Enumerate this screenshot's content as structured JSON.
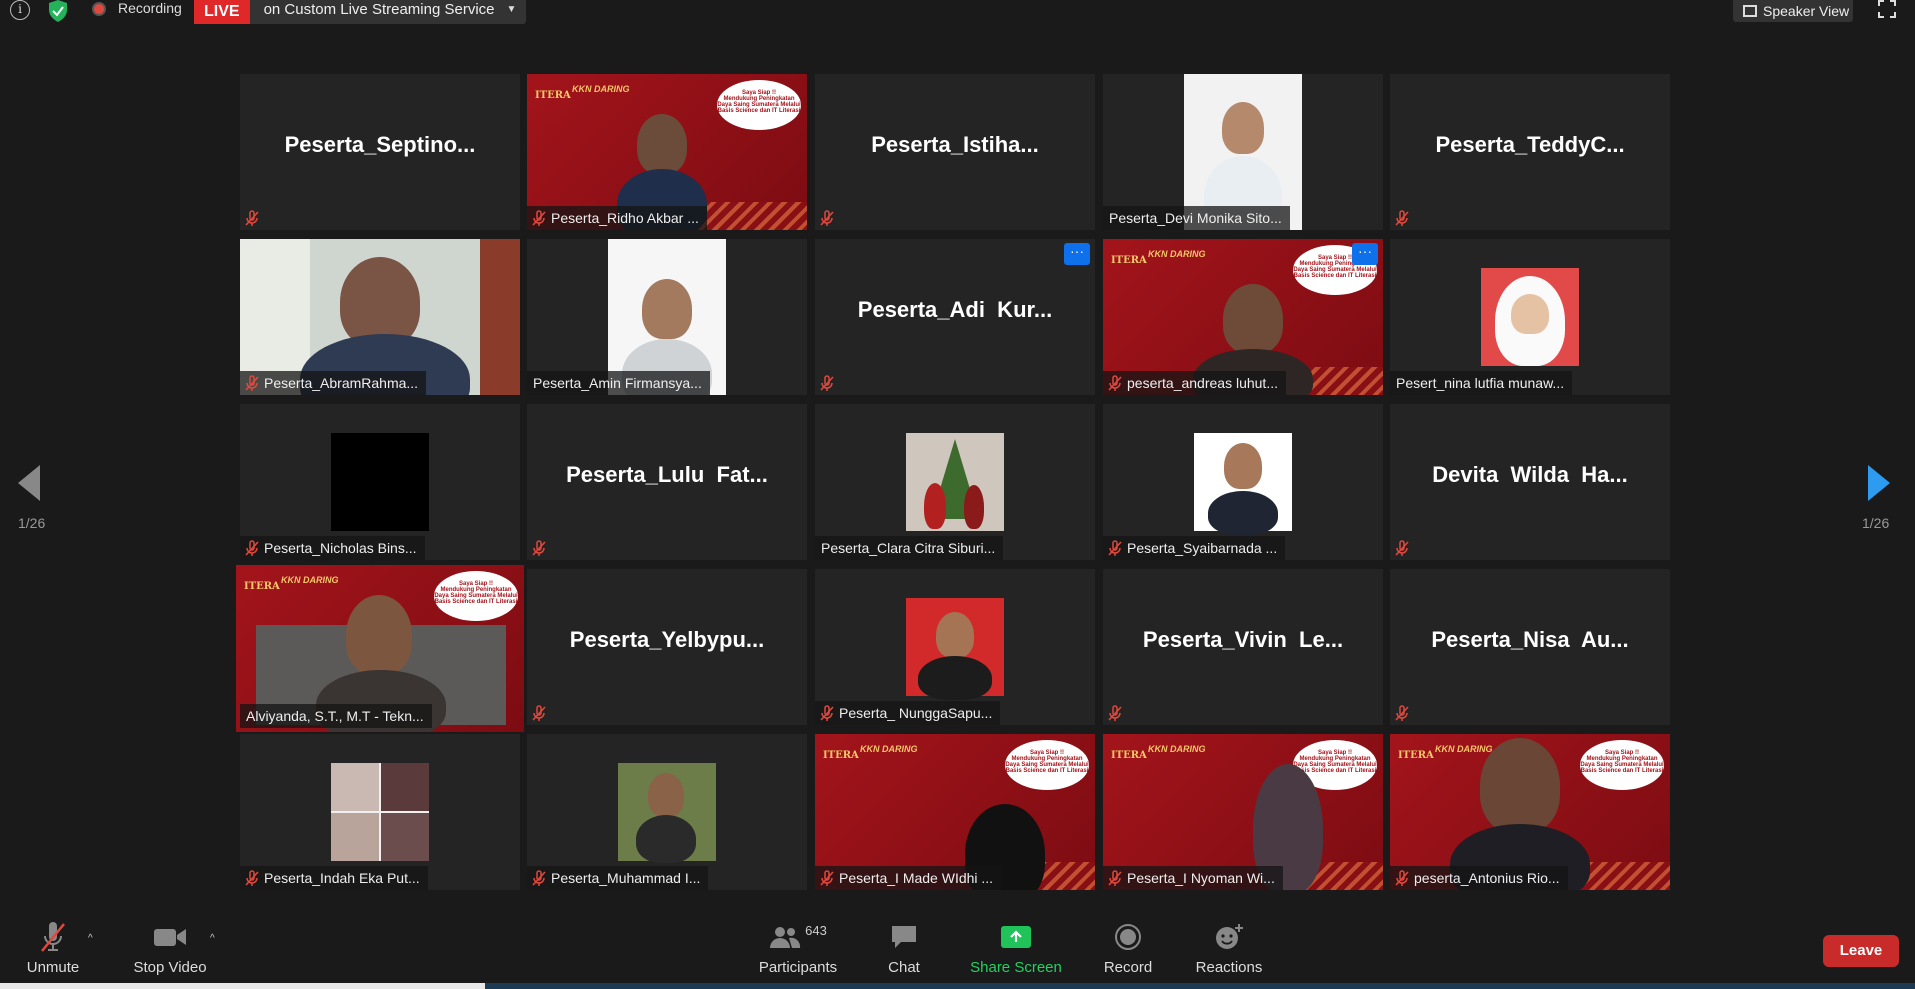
{
  "topbar": {
    "recording_label": "Recording",
    "live_badge": "LIVE",
    "live_text": "on Custom Live Streaming Service",
    "speaker_view_label": "Speaker View"
  },
  "navigation": {
    "prev_page": "1/26",
    "next_page": "1/26"
  },
  "tiles": [
    {
      "kind": "name",
      "big": "Peserta_Septino...",
      "label": ""
    },
    {
      "kind": "banner",
      "label": "Peserta_Ridho Akbar ..."
    },
    {
      "kind": "name",
      "big": "Peserta_Istiha...",
      "label": ""
    },
    {
      "kind": "photo",
      "label": "Peserta_Devi Monika Sito..."
    },
    {
      "kind": "name",
      "big": "Peserta_TeddyC...",
      "label": ""
    },
    {
      "kind": "video",
      "label": "Peserta_AbramRahma..."
    },
    {
      "kind": "photo",
      "label": "Peserta_Amin Firmansya..."
    },
    {
      "kind": "name",
      "big": "Peserta_Adi  Kur...",
      "label": ""
    },
    {
      "kind": "banner",
      "label": "peserta_andreas luhut..."
    },
    {
      "kind": "photo",
      "label": "Pesert_nina lutfia munaw..."
    },
    {
      "kind": "photo",
      "label": "Peserta_Nicholas Bins..."
    },
    {
      "kind": "name",
      "big": "Peserta_Lulu  Fat...",
      "label": ""
    },
    {
      "kind": "photo",
      "label": "Peserta_Clara Citra Siburi..."
    },
    {
      "kind": "photo",
      "label": "Peserta_Syaibarnada ..."
    },
    {
      "kind": "name",
      "big": "Devita  Wilda  Ha...",
      "label": ""
    },
    {
      "kind": "banner",
      "label": "Alviyanda, S.T., M.T - Tekn..."
    },
    {
      "kind": "name",
      "big": "Peserta_Yelbypu...",
      "label": ""
    },
    {
      "kind": "photo",
      "label": "Peserta_ NunggaSapu..."
    },
    {
      "kind": "name",
      "big": "Peserta_Vivin  Le...",
      "label": ""
    },
    {
      "kind": "name",
      "big": "Peserta_Nisa  Au...",
      "label": ""
    },
    {
      "kind": "photo",
      "label": "Peserta_Indah Eka Put..."
    },
    {
      "kind": "photo",
      "label": "Peserta_Muhammad I..."
    },
    {
      "kind": "banner",
      "label": "Peserta_I Made WIdhi ..."
    },
    {
      "kind": "banner",
      "label": "Peserta_I Nyoman Wi..."
    },
    {
      "kind": "banner",
      "label": "peserta_Antonius Rio..."
    }
  ],
  "banner_text": {
    "itera": "ITERA",
    "kkn": "KKN DARING",
    "bubble_title": "Saya Siap !!",
    "bubble_text": "Mendukung Peningkatan Daya Saing Sumatera Melalui Basis Science dan IT Literasi"
  },
  "toolbar": {
    "unmute": "Unmute",
    "stop_video": "Stop Video",
    "participants": "Participants",
    "participants_count": "643",
    "chat": "Chat",
    "share_screen": "Share Screen",
    "record": "Record",
    "reactions": "Reactions",
    "leave": "Leave"
  },
  "colors": {
    "accent_blue": "#0e71eb",
    "live_red": "#e02828",
    "share_green": "#20c25a",
    "leave_red": "#c92a2a",
    "active_speaker": "#e3e592",
    "banner_red": "#a3141b"
  }
}
